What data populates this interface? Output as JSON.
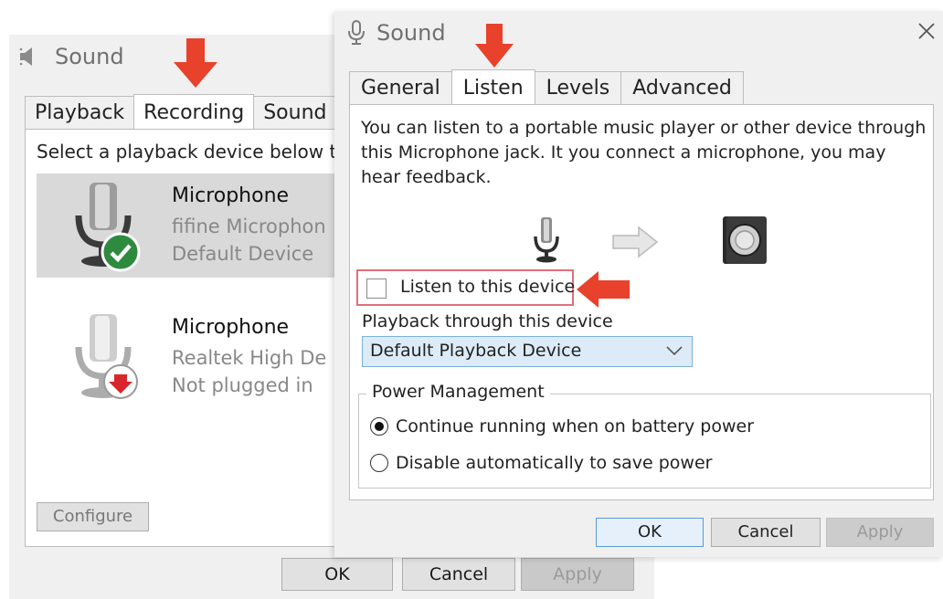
{
  "back_window": {
    "title": "Sound",
    "tabs": [
      "Playback",
      "Recording",
      "Sound"
    ],
    "active_tab": "Recording",
    "instructions": "Select a playback device below to",
    "devices": [
      {
        "name": "Microphone",
        "line1": "fifine Microphon",
        "line2": "Default Device",
        "status": "default"
      },
      {
        "name": "Microphone",
        "line1": "Realtek High De",
        "line2": "Not plugged in",
        "status": "unplugged"
      }
    ],
    "configure_label": "Configure",
    "ok_label": "OK",
    "cancel_label": "Cancel",
    "apply_label": "Apply"
  },
  "front_window": {
    "title": "Sound",
    "tabs": [
      "General",
      "Listen",
      "Levels",
      "Advanced"
    ],
    "active_tab": "Listen",
    "description": "You can listen to a portable music player or other device through this Microphone jack. It you connect a microphone, you may hear feedback.",
    "listen_checkbox_label": "Listen to this device",
    "listen_checked": false,
    "playback_label": "Playback through this device",
    "playback_value": "Default Playback Device",
    "power_group_label": "Power Management",
    "radio_continue": "Continue running when on battery power",
    "radio_disable": "Disable automatically to save power",
    "selected_radio": "continue",
    "ok_label": "OK",
    "cancel_label": "Cancel",
    "apply_label": "Apply"
  },
  "colors": {
    "annotation_arrow": "#e8412c",
    "listen_highlight": "#e0707a",
    "selected_row": "#d9d9d9",
    "dropdown_bg": "#dcebf7",
    "default_badge": "#2e8b3e",
    "unplugged_badge": "#d9262c"
  },
  "icons": {
    "back_title": "speaker-icon",
    "front_title": "microphone-icon",
    "close": "close-icon",
    "default_badge": "check-circle-icon",
    "unplugged_badge": "down-arrow-circle-icon",
    "flow_source": "microphone-icon",
    "flow_arrow": "right-arrow-icon",
    "flow_target": "speaker-icon",
    "dropdown": "chevron-down-icon",
    "annotation": "red-arrow-icon"
  }
}
